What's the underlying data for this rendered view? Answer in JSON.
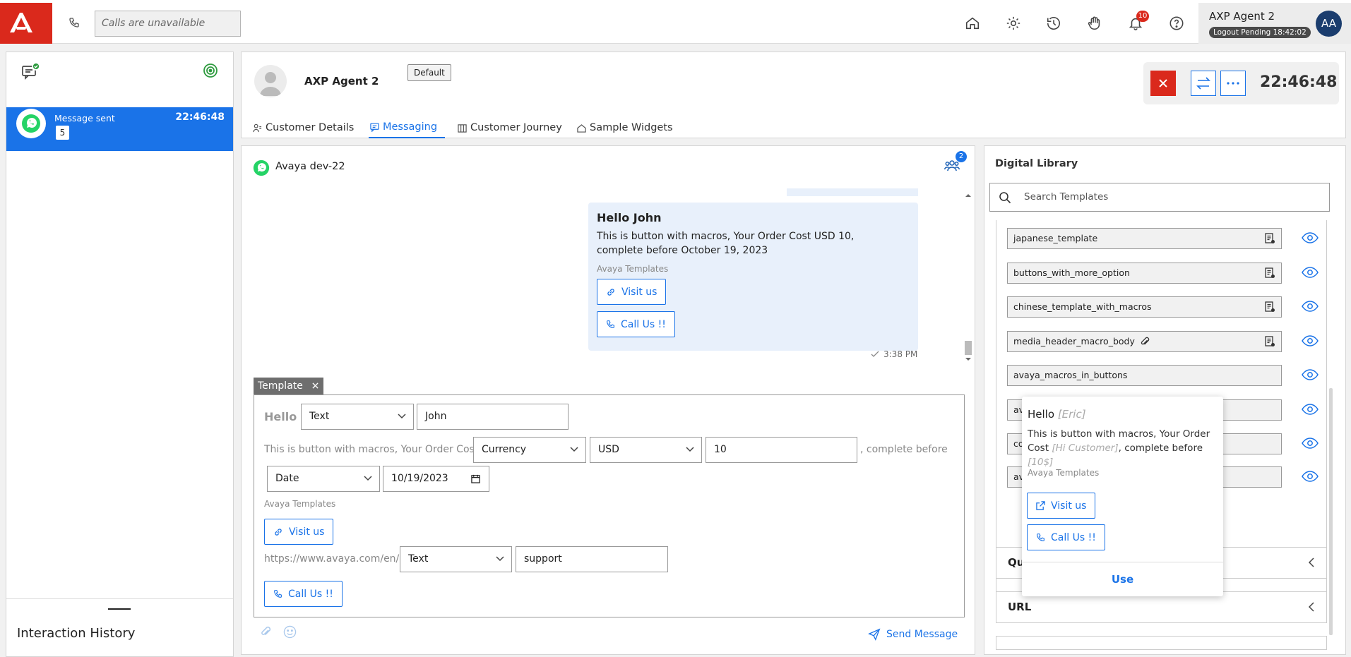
{
  "topbar": {
    "calls_placeholder": "Calls are unavailable",
    "notifications_count": "10",
    "agent_name": "AXP Agent 2",
    "logout_status": "Logout Pending 18:42:02",
    "avatar_initials": "AA",
    "icons": [
      "home-icon",
      "settings-icon",
      "history-icon",
      "hand-icon",
      "bell-icon",
      "help-icon"
    ]
  },
  "left": {
    "card": {
      "title": "Message sent",
      "time": "22:46:48",
      "count": "5"
    },
    "history_title": "Interaction History"
  },
  "header": {
    "contact_name": "AXP Agent 2",
    "default_badge": "Default",
    "timer": "22:46:48",
    "tabs": [
      {
        "label": "Customer Details",
        "icon": "person-icon"
      },
      {
        "label": "Messaging",
        "icon": "chat-icon"
      },
      {
        "label": "Customer Journey",
        "icon": "journey-icon"
      },
      {
        "label": "Sample Widgets",
        "icon": "home-icon"
      }
    ]
  },
  "chat": {
    "channel_name": "Avaya dev-22",
    "participants_count": "2",
    "message": {
      "title": "Hello John",
      "body": "This is button with macros, Your Order Cost USD 10, complete before October 19, 2023",
      "source": "Avaya Templates",
      "button1": "Visit us",
      "button2": "Call Us !!",
      "time": "3:38 PM"
    },
    "template": {
      "tag": "Template",
      "hello": "Hello",
      "sel1": "Text",
      "val1": "John",
      "body_prefix": "This is button with macros, Your Order Cost",
      "sel2": "Currency",
      "sel3": "USD",
      "val2": "10",
      "body_suffix": ", complete before",
      "sel4": "Date",
      "date": "10/19/2023",
      "source": "Avaya Templates",
      "visit_button": "Visit us",
      "url_prefix": "https://www.avaya.com/en/",
      "sel5": "Text",
      "val3": "support",
      "call_button": "Call Us !!"
    },
    "send_label": "Send Message"
  },
  "library": {
    "title": "Digital Library",
    "search_placeholder": "Search Templates",
    "templates": [
      "japanese_template",
      "buttons_with_more_option",
      "chinese_template_with_macros",
      "media_header_macro_body",
      "avaya_macros_in_buttons",
      "av",
      "co",
      "av"
    ],
    "accordions": [
      "Qu",
      "URL"
    ]
  },
  "preview": {
    "title": "Hello",
    "title_macro": "[Eric]",
    "body_1": "This is button with macros, Your Order Cost ",
    "body_macro1": "[Hi Customer]",
    "body_2": ", complete before ",
    "body_macro2": "[10$]",
    "source": "Avaya Templates",
    "button1": "Visit us",
    "button2": "Call Us !!",
    "use_label": "Use"
  },
  "colors": {
    "brand_red": "#da291c",
    "accent_blue": "#1a73e8",
    "whatsapp_green": "#25d366"
  }
}
